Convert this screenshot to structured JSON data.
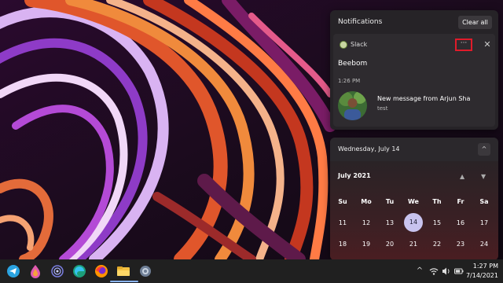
{
  "notifications": {
    "title": "Notifications",
    "clear_all_label": "Clear all",
    "card": {
      "app_name": "Slack",
      "more_label": "···",
      "close_label": "✕",
      "workspace": "Beebom",
      "time": "1:26 PM",
      "message_title": "New message from Arjun Sha",
      "message_body": "test"
    }
  },
  "calendar": {
    "date_header": "Wednesday, July 14",
    "collapse_label": "^",
    "month_label": "July 2021",
    "up_label": "▲",
    "down_label": "▼",
    "weekdays": [
      "Su",
      "Mo",
      "Tu",
      "We",
      "Th",
      "Fr",
      "Sa"
    ],
    "weeks": [
      [
        "11",
        "12",
        "13",
        "14",
        "15",
        "16",
        "17"
      ],
      [
        "18",
        "19",
        "20",
        "21",
        "22",
        "23",
        "24"
      ]
    ],
    "today": "14"
  },
  "taskbar": {
    "apps": [
      "telegram-icon",
      "edge-drop-icon",
      "tor-icon",
      "edge-icon",
      "firefox-icon",
      "file-explorer-icon",
      "settings-icon"
    ],
    "tray": {
      "chevron": "^",
      "wifi": "wifi",
      "volume": "volume",
      "battery": "battery"
    },
    "time": "1:27 PM",
    "date": "7/14/2021"
  },
  "colors": {
    "accent": "#c8c3ee",
    "highlight_border": "#e01b2a",
    "panel_bg": "#262327"
  }
}
